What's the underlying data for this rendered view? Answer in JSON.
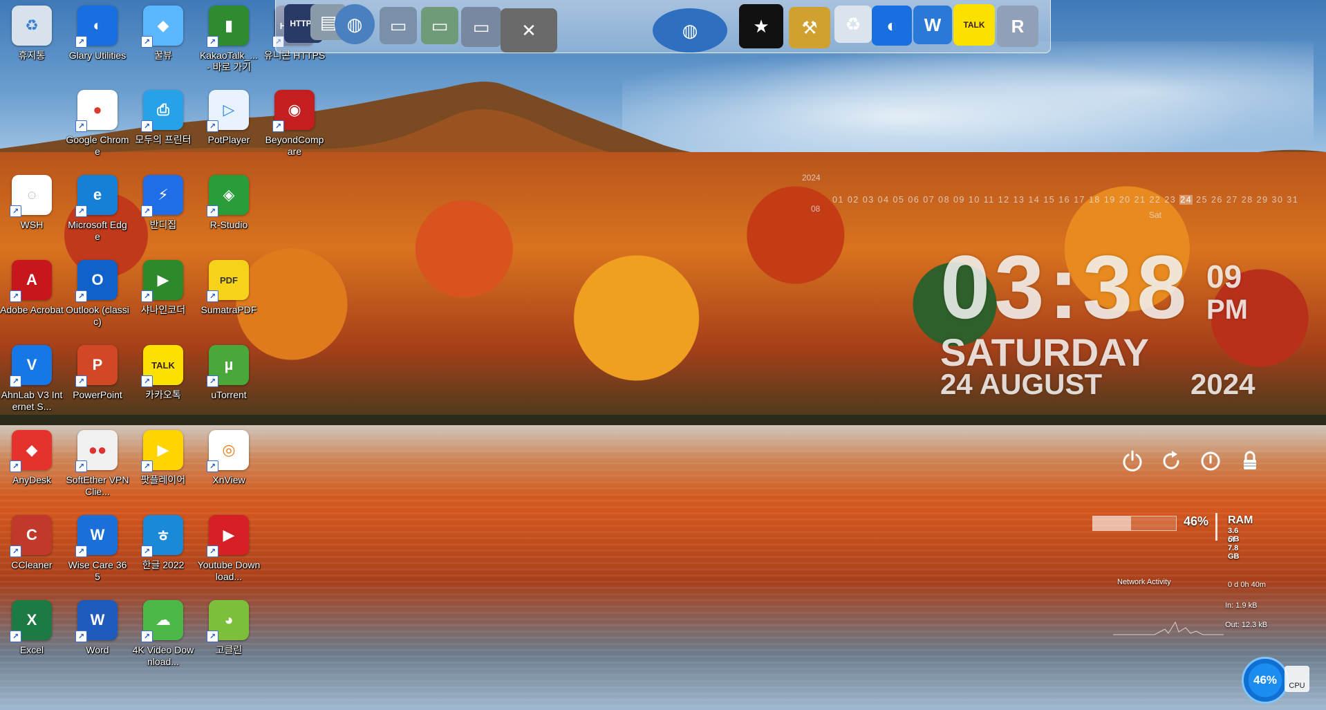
{
  "desktop_icons": [
    {
      "label": "휴지통",
      "glyph": "♻",
      "color": "#d8e2ec",
      "text": "#3b7fd1"
    },
    {
      "label": "Glary Utilities",
      "glyph": "◐",
      "color": "#1a6fe0",
      "text": "#fff"
    },
    {
      "label": "꿀뷰",
      "glyph": "◆",
      "color": "#5bb8ff",
      "text": "#fff"
    },
    {
      "label": "KakaoTalk_... - 바로 가기",
      "glyph": "▮",
      "color": "#2f8b2f",
      "text": "#fff"
    },
    {
      "label": "유니콘 HTTPS",
      "glyph": "HTTPS",
      "color": "#2a3a66",
      "text": "#fff"
    },
    {
      "label": "Google Chrome",
      "glyph": "●",
      "color": "#ffffff",
      "text": "#db3b2f"
    },
    {
      "label": "모두의 프린터",
      "glyph": "⎙",
      "color": "#27a2e8",
      "text": "#fff"
    },
    {
      "label": "PotPlayer",
      "glyph": "▷",
      "color": "#e9f2ff",
      "text": "#2a88ea"
    },
    {
      "label": "BeyondCompare",
      "glyph": "◉",
      "color": "#c41e1e",
      "text": "#fff"
    },
    {
      "label": "WSH",
      "glyph": "◌",
      "color": "#ffffff",
      "text": "#999"
    },
    {
      "label": "Microsoft Edge",
      "glyph": "e",
      "color": "#1580d6",
      "text": "#fff"
    },
    {
      "label": "반디집",
      "glyph": "⚡",
      "color": "#1f6ee8",
      "text": "#fff"
    },
    {
      "label": "R-Studio",
      "glyph": "◈",
      "color": "#2a9d3b",
      "text": "#fff"
    },
    {
      "label": "Adobe Acrobat",
      "glyph": "A",
      "color": "#c8161d",
      "text": "#fff"
    },
    {
      "label": "Outlook (classic)",
      "glyph": "O",
      "color": "#0f62c9",
      "text": "#fff"
    },
    {
      "label": "샤나인코더",
      "glyph": "▶",
      "color": "#2c8a2c",
      "text": "#fff"
    },
    {
      "label": "SumatraPDF",
      "glyph": "PDF",
      "color": "#f6d21b",
      "text": "#333"
    },
    {
      "label": "AhnLab V3 Internet S...",
      "glyph": "V",
      "color": "#1677e6",
      "text": "#fff"
    },
    {
      "label": "PowerPoint",
      "glyph": "P",
      "color": "#d24726",
      "text": "#fff"
    },
    {
      "label": "카카오톡",
      "glyph": "TALK",
      "color": "#fae100",
      "text": "#3a1d1d"
    },
    {
      "label": "uTorrent",
      "glyph": "µ",
      "color": "#4aa83a",
      "text": "#fff"
    },
    {
      "label": "AnyDesk",
      "glyph": "◆",
      "color": "#e5322d",
      "text": "#fff"
    },
    {
      "label": "SoftEther VPN Clie...",
      "glyph": "●●",
      "color": "#f0f0f0",
      "text": "#d33"
    },
    {
      "label": "팟플레이어",
      "glyph": "▶",
      "color": "#ffd400",
      "text": "#fff"
    },
    {
      "label": "XnView",
      "glyph": "◎",
      "color": "#ffffff",
      "text": "#e8801a"
    },
    {
      "label": "CCleaner",
      "glyph": "C",
      "color": "#c0392b",
      "text": "#fff"
    },
    {
      "label": "Wise Care 365",
      "glyph": "W",
      "color": "#1b6fd8",
      "text": "#fff"
    },
    {
      "label": "한글 2022",
      "glyph": "ㅎ",
      "color": "#1a8ad8",
      "text": "#fff"
    },
    {
      "label": "Youtube Download...",
      "glyph": "▶",
      "color": "#d71f26",
      "text": "#fff"
    },
    {
      "label": "Excel",
      "glyph": "X",
      "color": "#1d7a45",
      "text": "#fff"
    },
    {
      "label": "Word",
      "glyph": "W",
      "color": "#1f5bbd",
      "text": "#fff"
    },
    {
      "label": "4K Video Download...",
      "glyph": "☁",
      "color": "#4cb848",
      "text": "#fff"
    },
    {
      "label": "고클린",
      "glyph": "◕",
      "color": "#7bbf3a",
      "text": "#fff"
    }
  ],
  "dock_items": [
    {
      "name": "https-app-icon",
      "glyph": "HTTPS",
      "color": "#2a3a66"
    },
    {
      "name": "documents-icon",
      "glyph": "▤",
      "color": "#8a9aa8"
    },
    {
      "name": "network-globe-icon",
      "glyph": "◍",
      "color": "#4a7fc0"
    },
    {
      "name": "folder-icon",
      "glyph": "▭",
      "color": "#7a90a8"
    },
    {
      "name": "folder-green-icon",
      "glyph": "▭",
      "color": "#6f9b78"
    },
    {
      "name": "folder-pictures-icon",
      "glyph": "▭",
      "color": "#7888a0"
    },
    {
      "name": "system-tools-icon",
      "glyph": "✕",
      "color": "#6a6a6a"
    },
    {
      "name": "internet-globe-icon",
      "glyph": "◍",
      "color": "#2f6fc0"
    },
    {
      "name": "tshirt-icon",
      "glyph": "★",
      "color": "#111111"
    },
    {
      "name": "tools-hammer-icon",
      "glyph": "⚒",
      "color": "#d0a030"
    },
    {
      "name": "recycle-bin-icon",
      "glyph": "♻",
      "color": "#dbe4ec"
    },
    {
      "name": "glary-utilities-icon",
      "glyph": "◐",
      "color": "#1a6fe0"
    },
    {
      "name": "wise-care-icon",
      "glyph": "W",
      "color": "#2a78d8"
    },
    {
      "name": "kakaotalk-icon",
      "glyph": "TALK",
      "color": "#fae100"
    },
    {
      "name": "r-studio-icon",
      "glyph": "R",
      "color": "#8fa0b8"
    }
  ],
  "calendar": {
    "year": "2024",
    "month": "08",
    "days_before": "01 02 03 04 05 06 07 08 09 10 11 12 13 14 15 16 17 18 19 20 21 22 23",
    "today": "24",
    "days_after": "25 26 27 28 29 30 31",
    "today_dow": "Sat"
  },
  "clock": {
    "time": "03:38",
    "seconds": "09",
    "ampm": "PM",
    "day": "SATURDAY",
    "date": "24 AUGUST",
    "year": "2024"
  },
  "ram": {
    "percent": "46%",
    "label": "RAM",
    "used": "3.6 GB",
    "total": "of 7.8 GB",
    "fill": 0.46
  },
  "network": {
    "title": "Network Activity",
    "uptime": "0 d 0h 40m",
    "in": "In: 1.9 kB",
    "out": "Out: 12.3 kB"
  },
  "cpu": {
    "percent": "46%",
    "label": "CPU"
  }
}
